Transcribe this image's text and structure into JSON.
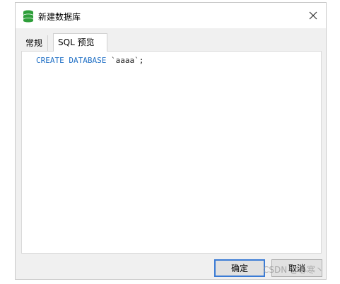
{
  "window": {
    "title": "新建数据库",
    "icon": "database-stack-icon"
  },
  "tabs": [
    {
      "label": "常规",
      "active": false
    },
    {
      "label": "SQL 预览",
      "active": true
    }
  ],
  "sql": {
    "keyword": "CREATE DATABASE",
    "name": "`aaaa`",
    "end": ";"
  },
  "buttons": {
    "ok": "确定",
    "cancel": "取消"
  },
  "watermark": "CSDN @心寒丶",
  "colors": {
    "keyword": "#1f6fc5",
    "icon_green": "#2e9e3a",
    "ok_border": "#3a7bd5"
  }
}
